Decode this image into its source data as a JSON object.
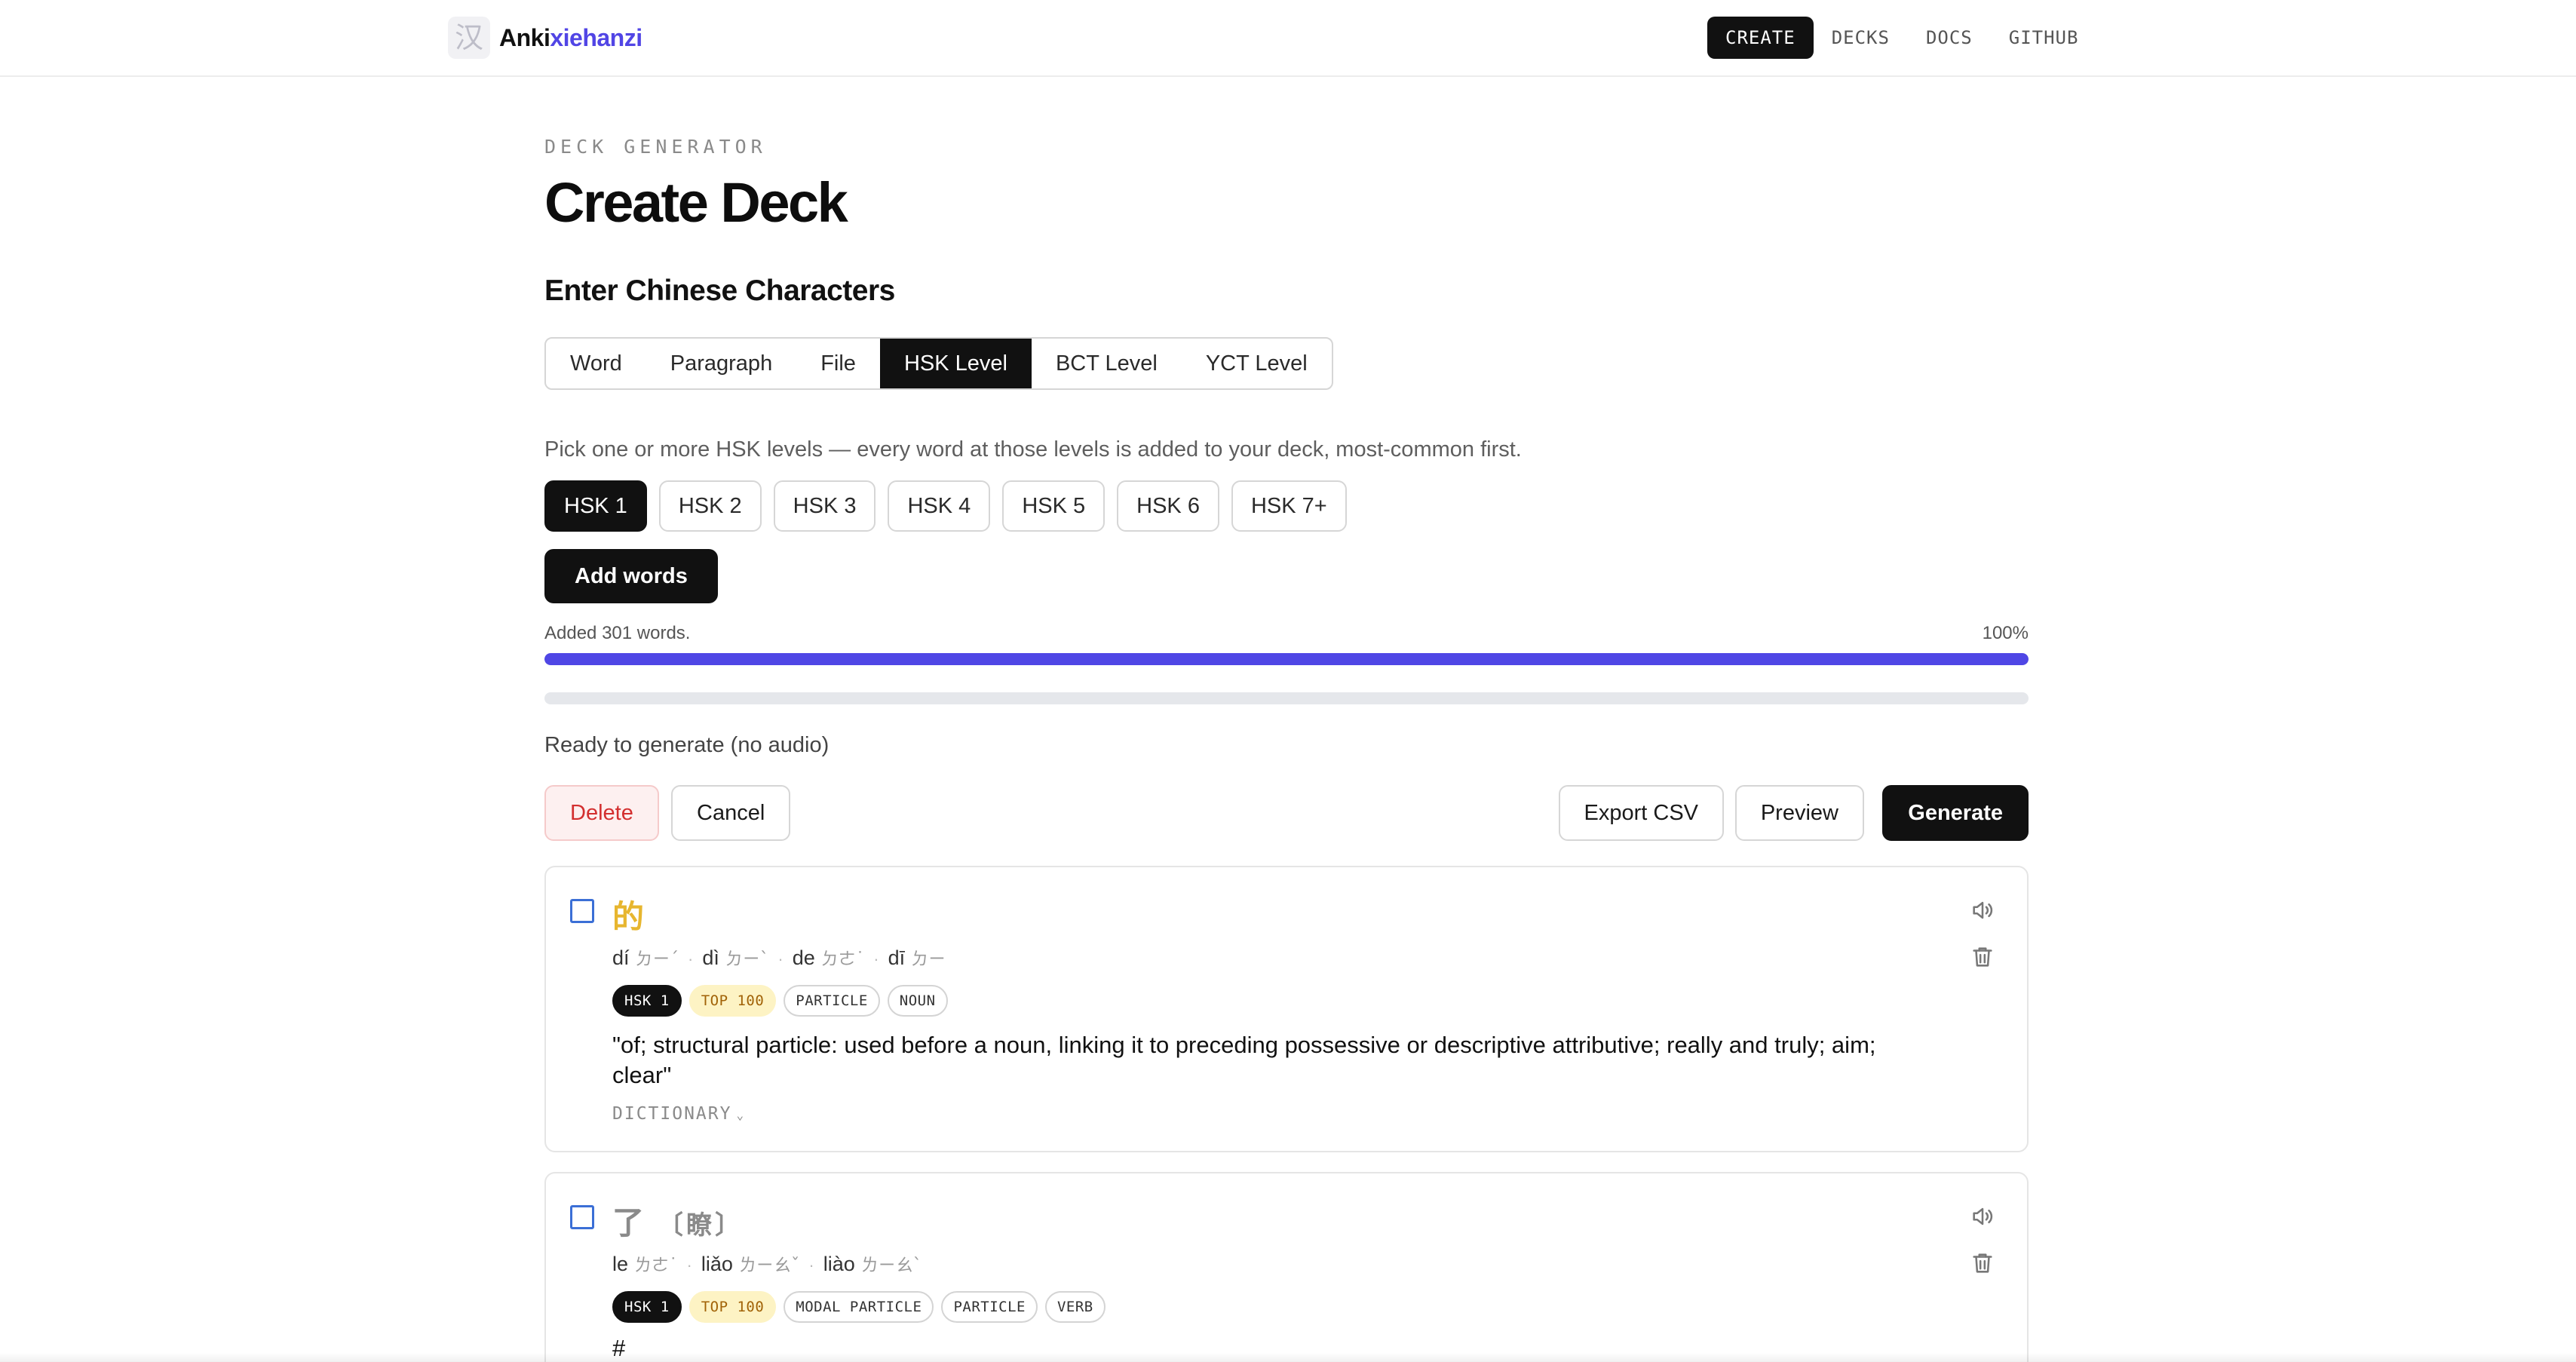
{
  "brand": {
    "logo_glyph": "汉",
    "name_part1": "Anki",
    "name_part2": "xiehanzi",
    "accent": "#5145e5"
  },
  "nav": {
    "items": [
      {
        "label": "CREATE",
        "active": true
      },
      {
        "label": "DECKS"
      },
      {
        "label": "DOCS"
      },
      {
        "label": "GITHUB"
      }
    ]
  },
  "page": {
    "eyebrow": "DECK GENERATOR",
    "title": "Create Deck",
    "section_title": "Enter Chinese Characters"
  },
  "input_tabs": [
    {
      "label": "Word"
    },
    {
      "label": "Paragraph"
    },
    {
      "label": "File"
    },
    {
      "label": "HSK Level",
      "active": true
    },
    {
      "label": "BCT Level"
    },
    {
      "label": "YCT Level"
    }
  ],
  "hsk": {
    "help_text": "Pick one or more HSK levels — every word at those levels is added to your deck, most-common first.",
    "levels": [
      {
        "label": "HSK 1",
        "selected": true
      },
      {
        "label": "HSK 2"
      },
      {
        "label": "HSK 3"
      },
      {
        "label": "HSK 4"
      },
      {
        "label": "HSK 5"
      },
      {
        "label": "HSK 6"
      },
      {
        "label": "HSK 7+"
      }
    ],
    "add_button": "Add words"
  },
  "progress": {
    "label": "Added 301 words.",
    "percent_label": "100%",
    "primary_fraction": 1.0,
    "secondary_fraction": 0.0,
    "bar_color": "#4f46e5"
  },
  "status": "Ready to generate (no audio)",
  "actions": {
    "delete": "Delete",
    "cancel": "Cancel",
    "export_csv": "Export CSV",
    "preview": "Preview",
    "generate": "Generate"
  },
  "cards": [
    {
      "hanzi": "的",
      "traditional": "",
      "readings": [
        {
          "pinyin": "dí",
          "zhuyin": "ㄉㄧˊ"
        },
        {
          "pinyin": "dì",
          "zhuyin": "ㄉㄧˋ"
        },
        {
          "pinyin": "de",
          "zhuyin": "ㄉㄜ˙"
        },
        {
          "pinyin": "dī",
          "zhuyin": "ㄉㄧ"
        }
      ],
      "tags": [
        "HSK 1",
        "TOP 100",
        "PARTICLE",
        "NOUN"
      ],
      "definition": "\"of; structural particle: used before a noun, linking it to preceding possessive or descriptive attributive; really and truly; aim; clear\"",
      "dictionary_label": "DICTIONARY"
    },
    {
      "hanzi": "了",
      "traditional": "〔瞭〕",
      "readings": [
        {
          "pinyin": "le",
          "zhuyin": "ㄌㄜ˙"
        },
        {
          "pinyin": "liǎo",
          "zhuyin": "ㄌㄧㄠˇ"
        },
        {
          "pinyin": "liào",
          "zhuyin": "ㄌㄧㄠˋ"
        }
      ],
      "tags": [
        "HSK 1",
        "TOP 100",
        "MODAL PARTICLE",
        "PARTICLE",
        "VERB"
      ],
      "definition": "#"
    }
  ]
}
